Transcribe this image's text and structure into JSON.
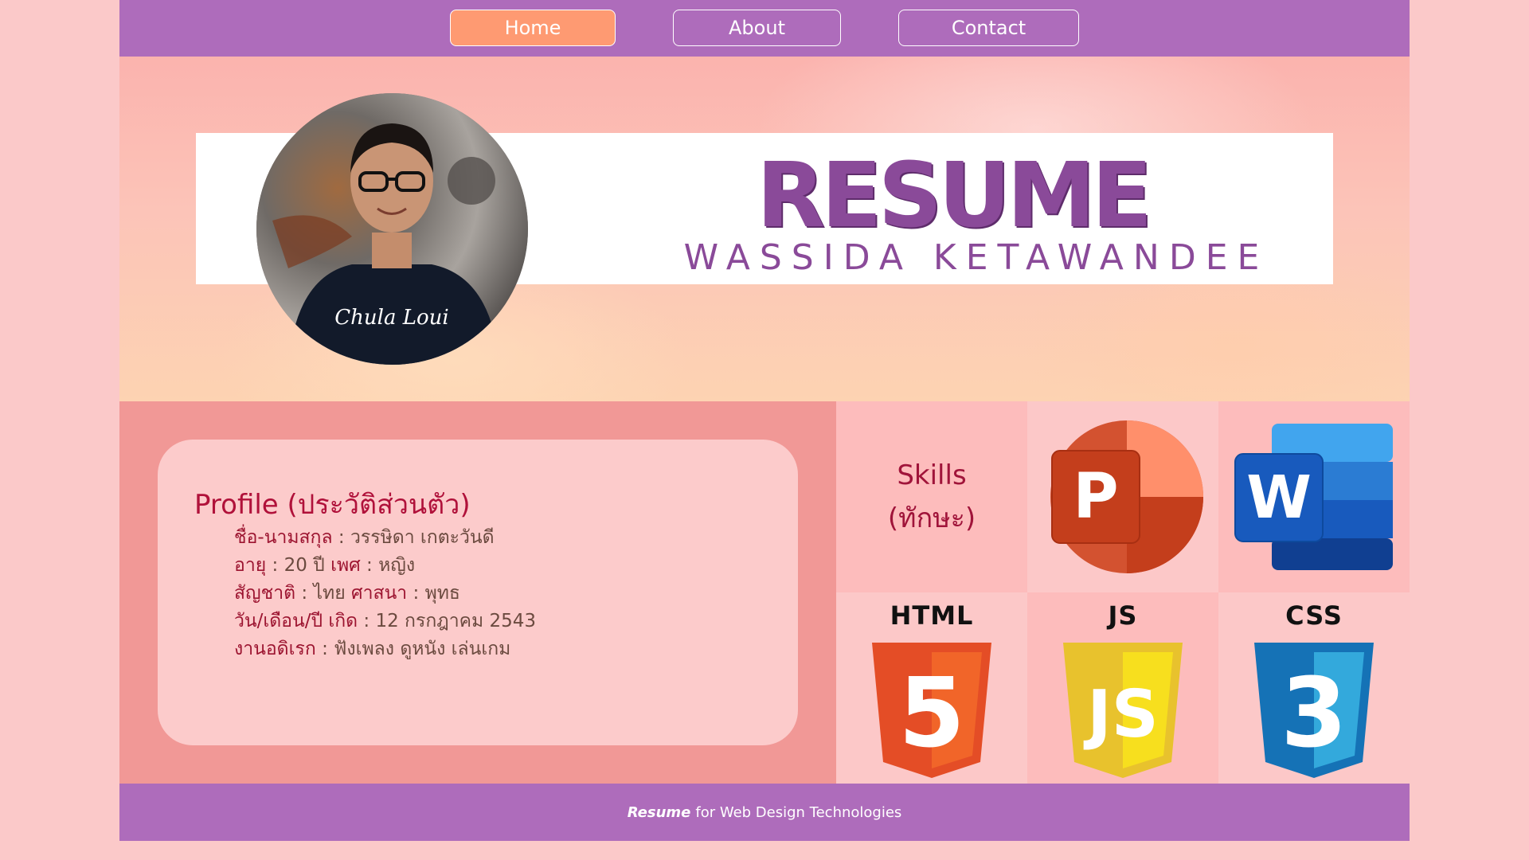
{
  "nav": {
    "items": [
      {
        "label": "Home",
        "active": true
      },
      {
        "label": "About",
        "active": false
      },
      {
        "label": "Contact",
        "active": false
      }
    ]
  },
  "hero": {
    "title": "RESUME",
    "name": "WASSIDA KETAWANDEE",
    "avatar_icon": "person-photo-icon",
    "shirt_text": "Chula Loui"
  },
  "profile": {
    "title": "Profile (ประวัติส่วนตัว)",
    "lines": [
      {
        "label": "ชื่อ-นามสกุล",
        "value": "วรรษิดา เกตะวันดี"
      },
      {
        "label": "อายุ",
        "value": "20 ปี",
        "label2": "เพศ",
        "value2": "หญิง"
      },
      {
        "label": "สัญชาติ",
        "value": "ไทย",
        "label2": "ศาสนา",
        "value2": "พุทธ"
      },
      {
        "label": "วัน/เดือน/ปี เกิด",
        "value": "12 กรกฎาคม 2543"
      },
      {
        "label": "งานอดิเรก",
        "value": "ฟังเพลง ดูหนัง เล่นเกม"
      }
    ],
    "separator": " : "
  },
  "skills": {
    "label_line1": "Skills",
    "label_line2": "(ทักษะ)",
    "logos": [
      {
        "icon": "powerpoint-icon",
        "letter": "P"
      },
      {
        "icon": "word-icon",
        "letter": "W"
      },
      {
        "icon": "html5-icon",
        "caption": "HTML",
        "digit": "5"
      },
      {
        "icon": "javascript-icon",
        "caption": "JS",
        "digit": "JS"
      },
      {
        "icon": "css3-icon",
        "caption": "CSS",
        "digit": "3"
      }
    ]
  },
  "footer": {
    "brand": "Resume",
    "text": "for Web Design Technologies"
  },
  "colors": {
    "nav_bg": "#ae6cbb",
    "active_btn": "#fe9a72",
    "title": "#8a4a99",
    "profile_accent": "#b0113a"
  }
}
